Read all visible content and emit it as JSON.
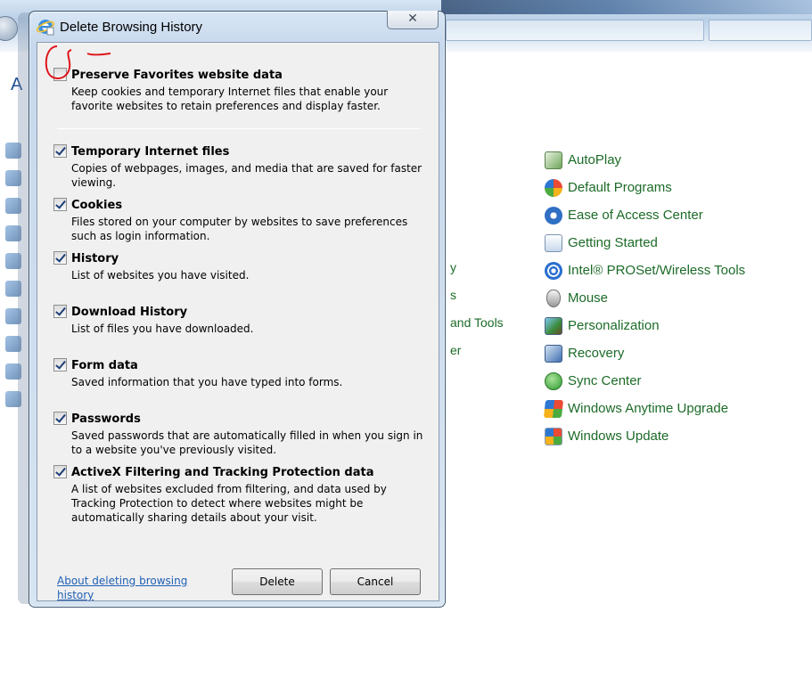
{
  "background": {
    "heading_partial": "A",
    "partial_labels": [
      "y",
      "s",
      "and Tools",
      "er"
    ],
    "control_panel_items": [
      {
        "label": "AutoPlay",
        "icon": "autoplay-icon"
      },
      {
        "label": "Default Programs",
        "icon": "default-programs-icon"
      },
      {
        "label": "Ease of Access Center",
        "icon": "ease-of-access-icon"
      },
      {
        "label": "Getting Started",
        "icon": "getting-started-icon"
      },
      {
        "label": "Intel® PROSet/Wireless Tools",
        "icon": "wireless-icon"
      },
      {
        "label": "Mouse",
        "icon": "mouse-icon"
      },
      {
        "label": "Personalization",
        "icon": "personalization-icon"
      },
      {
        "label": "Recovery",
        "icon": "recovery-icon"
      },
      {
        "label": "Sync Center",
        "icon": "sync-center-icon"
      },
      {
        "label": "Windows Anytime Upgrade",
        "icon": "anytime-upgrade-icon"
      },
      {
        "label": "Windows Update",
        "icon": "windows-update-icon"
      }
    ],
    "link_color": "#1c6b28"
  },
  "dialog": {
    "title": "Delete Browsing History",
    "close_label": "✕",
    "options": [
      {
        "title": "Preserve Favorites website data",
        "checked": false,
        "desc": "Keep cookies and temporary Internet files that enable your favorite websites to retain preferences and display faster."
      },
      {
        "title": "Temporary Internet files",
        "checked": true,
        "desc": "Copies of webpages, images, and media that are saved for faster viewing."
      },
      {
        "title": "Cookies",
        "checked": true,
        "desc": "Files stored on your computer by websites to save preferences such as login information."
      },
      {
        "title": "History",
        "checked": true,
        "desc": "List of websites you have visited."
      },
      {
        "title": "Download History",
        "checked": true,
        "desc": "List of files you have downloaded."
      },
      {
        "title": "Form data",
        "checked": true,
        "desc": "Saved information that you have typed into forms."
      },
      {
        "title": "Passwords",
        "checked": true,
        "desc": "Saved passwords that are automatically filled in when you sign in to a website you've previously visited."
      },
      {
        "title": "ActiveX Filtering and Tracking Protection data",
        "checked": true,
        "desc": "A list of websites excluded from filtering, and data used by Tracking Protection to detect where websites might be automatically sharing details about your visit."
      }
    ],
    "about_link": "About deleting browsing history",
    "delete_label": "Delete",
    "cancel_label": "Cancel",
    "link_color": "#1f5fb5",
    "annotation_color": "#e0141c"
  }
}
